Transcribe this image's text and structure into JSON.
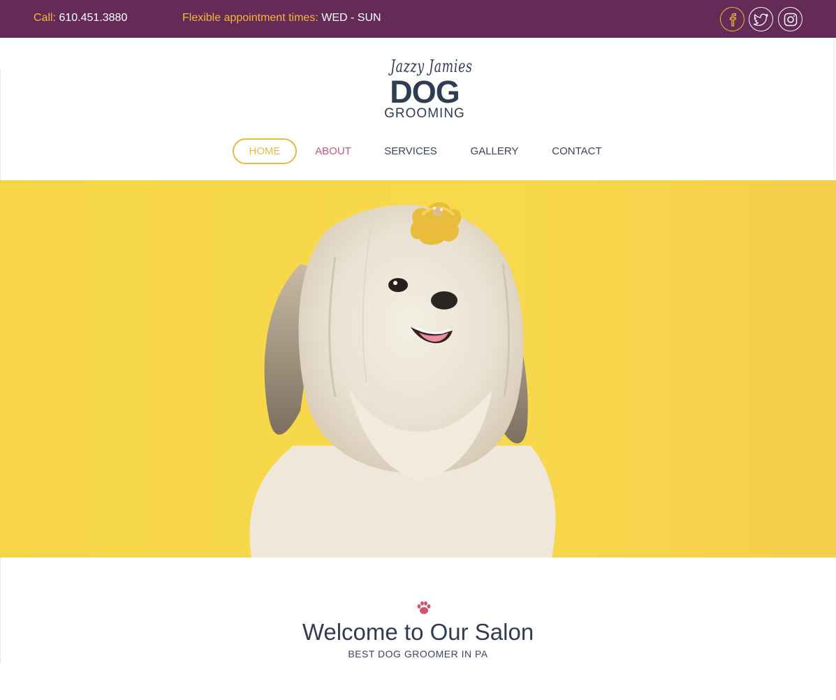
{
  "topbar": {
    "call_label": "Call:",
    "call_value": "610.451.3880",
    "hours_label": "Flexible appointment times:",
    "hours_value": "WED - SUN",
    "social": [
      {
        "icon": "facebook-icon"
      },
      {
        "icon": "twitter-icon"
      },
      {
        "icon": "instagram-icon"
      }
    ]
  },
  "logo": {
    "script": "Jazzy Jamies",
    "main": "DOG",
    "sub": "GROOMING"
  },
  "nav": {
    "items": [
      {
        "label": "HOME",
        "active": true
      },
      {
        "label": "ABOUT"
      },
      {
        "label": "SERVICES"
      },
      {
        "label": "GALLERY"
      },
      {
        "label": "CONTACT"
      }
    ]
  },
  "hero": {
    "background": "#f7d648",
    "subject": "white shih tzu dog with yellow bow"
  },
  "welcome": {
    "icon": "paw-icon",
    "title": "Welcome to Our Salon",
    "subtitle": "BEST DOG GROOMER IN PA"
  },
  "colors": {
    "topbar_bg": "#652b57",
    "accent_gold": "#f2b83a",
    "nav_active": "#e2bd3f",
    "nav_hover_pink": "#c4577a",
    "text_dark": "#2f3d52",
    "hero_yellow": "#f7d648"
  }
}
